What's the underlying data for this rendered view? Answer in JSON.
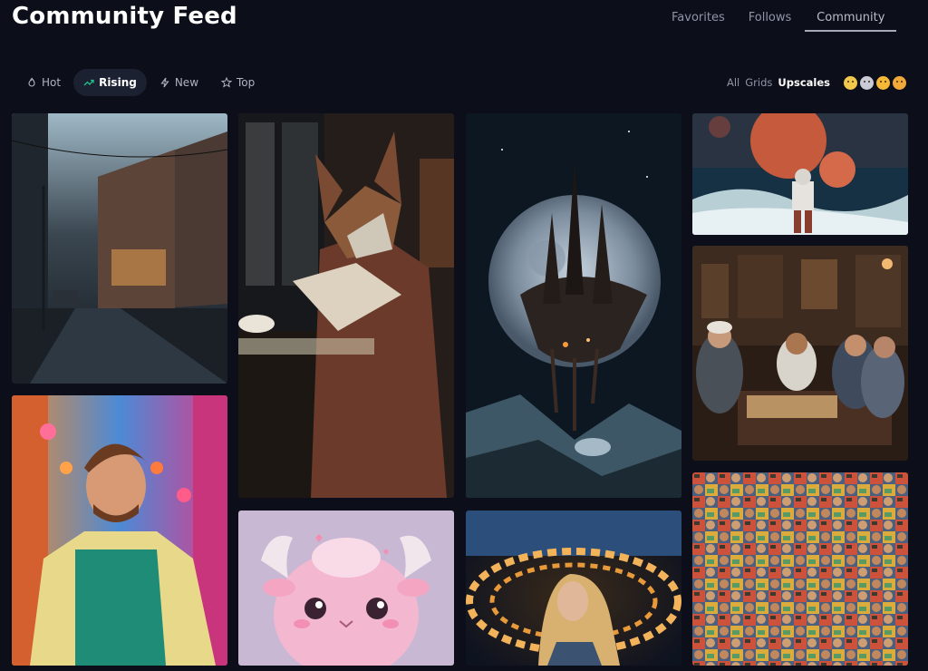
{
  "header": {
    "title": "Community Feed",
    "tabs": [
      "Favorites",
      "Follows",
      "Community"
    ]
  },
  "filters": {
    "items": [
      {
        "label": "Hot",
        "icon": "flame-icon"
      },
      {
        "label": "Rising",
        "icon": "trending-up-icon"
      },
      {
        "label": "New",
        "icon": "bolt-icon"
      },
      {
        "label": "Top",
        "icon": "star-icon"
      }
    ],
    "active": "Rising"
  },
  "view": {
    "options": [
      "All",
      "Grids",
      "Upscales"
    ],
    "active": "Upscales"
  },
  "reactions": [
    "grimace-emoji",
    "skull-emoji",
    "grin-emoji",
    "heart-eyes-emoji"
  ],
  "colors": {
    "background": "#0c0e19",
    "accent_green": "#23c28a",
    "pill_bg": "#1c2131"
  },
  "gallery": [
    {
      "name": "rainy-street-image"
    },
    {
      "name": "colorful-street-man-image"
    },
    {
      "name": "fox-reading-image"
    },
    {
      "name": "pink-creature-image"
    },
    {
      "name": "floating-city-moon-image"
    },
    {
      "name": "ring-light-woman-image"
    },
    {
      "name": "astronaut-planets-image"
    },
    {
      "name": "chess-players-image"
    },
    {
      "name": "comic-crowd-image"
    }
  ]
}
